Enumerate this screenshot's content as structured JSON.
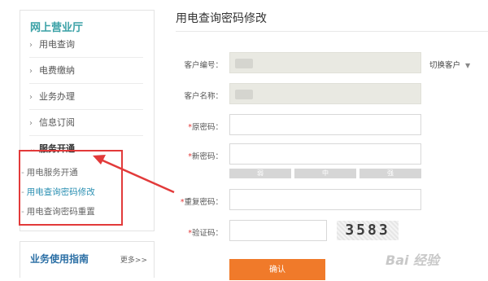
{
  "sidebar": {
    "title": "网上营业厅",
    "items": [
      {
        "label": "用电查询"
      },
      {
        "label": "电费缴纳"
      },
      {
        "label": "业务办理"
      },
      {
        "label": "信息订阅"
      },
      {
        "label": "服务开通"
      }
    ],
    "sub_items": [
      {
        "label": "用电服务开通"
      },
      {
        "label": "用电查询密码修改"
      },
      {
        "label": "用电查询密码重置"
      }
    ]
  },
  "guide": {
    "title": "业务使用指南",
    "more": "更多>>"
  },
  "form": {
    "title": "用电查询密码修改",
    "customer_no_label": "客户编号：",
    "customer_name_label": "客户名称：",
    "old_pwd_label": "原密码：",
    "new_pwd_label": "新密码：",
    "repeat_pwd_label": "重复密码：",
    "captcha_label": "验证码：",
    "switch_label": "切换客户",
    "strength": [
      "弱",
      "中",
      "强"
    ],
    "captcha_value": "3583",
    "confirm_label": "确认"
  },
  "watermark": "Bai 经验",
  "colors": {
    "accent": "#3aa1a6",
    "link_active": "#2a8fb2",
    "annotation": "#e23a3a",
    "button": "#f07a2a"
  }
}
